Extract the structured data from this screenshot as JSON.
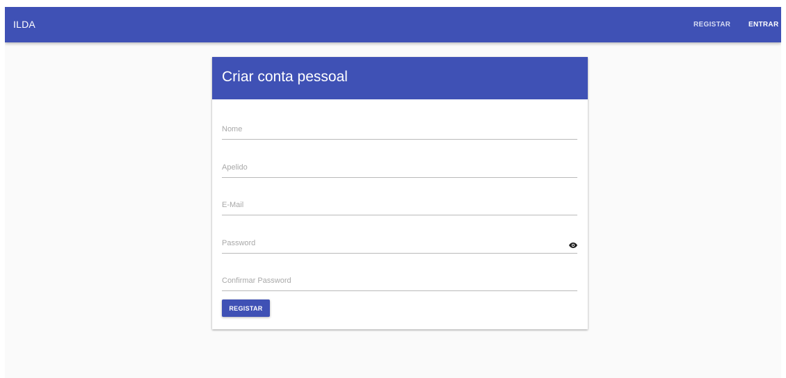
{
  "appbar": {
    "brand": "ILDA",
    "nav": {
      "register_label": "REGISTAR",
      "login_label": "ENTRAR"
    }
  },
  "card": {
    "title": "Criar conta pessoal",
    "fields": {
      "name": {
        "placeholder": "Nome",
        "value": ""
      },
      "surname": {
        "placeholder": "Apelido",
        "value": ""
      },
      "email": {
        "placeholder": "E-Mail",
        "value": ""
      },
      "password": {
        "placeholder": "Password",
        "value": ""
      },
      "confirm_password": {
        "placeholder": "Confirmar Password",
        "value": ""
      }
    },
    "password_toggle_icon": "eye-icon",
    "submit_label": "REGISTAR"
  },
  "colors": {
    "primary": "#3f51b5",
    "background": "#fafafa",
    "card": "#ffffff"
  }
}
